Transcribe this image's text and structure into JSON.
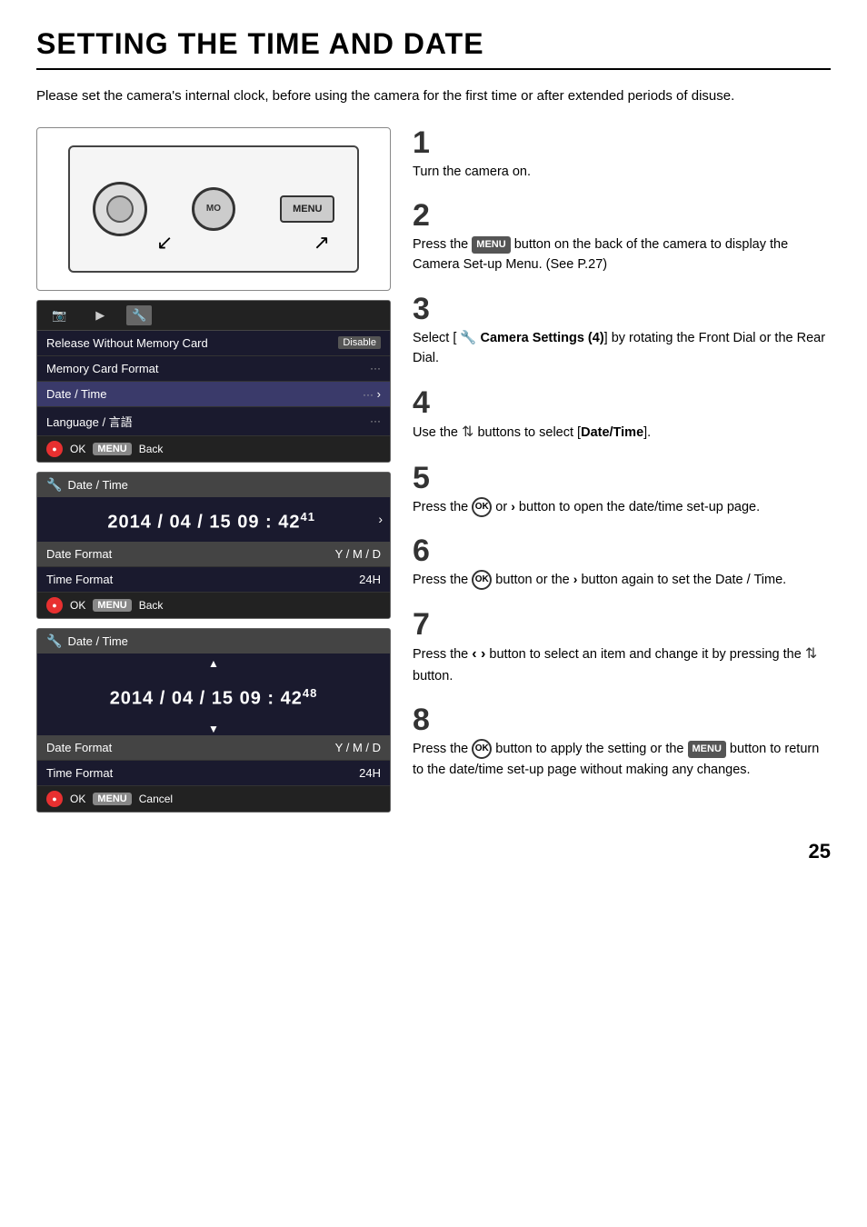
{
  "page": {
    "title": "SETTING THE TIME AND DATE",
    "intro": "Please set the camera's internal clock, before using the camera for the first time or after extended periods of disuse.",
    "page_number": "25"
  },
  "camera_diagram": {
    "mo_label": "MO",
    "menu_label": "MENU"
  },
  "menu_screen1": {
    "tabs": [
      "📷",
      "▶",
      "🔧"
    ],
    "rows": [
      {
        "label": "Release Without Memory Card",
        "value": "Disable"
      },
      {
        "label": "Memory Card Format",
        "value": "···"
      },
      {
        "label": "Date / Time",
        "value": "··· ›"
      },
      {
        "label": "Language / 言語",
        "value": "···"
      }
    ],
    "footer_ok": "OK",
    "footer_menu": "MENU",
    "footer_back": "Back"
  },
  "datetime_screen1": {
    "title": "Date / Time",
    "datetime_value": "2014 / 04 / 15   09 : 42",
    "seconds": "41",
    "date_format_label": "Date Format",
    "date_format_value": "Y / M / D",
    "time_format_label": "Time Format",
    "time_format_value": "24H",
    "footer_ok": "OK",
    "footer_menu": "MENU",
    "footer_back": "Back"
  },
  "datetime_screen2": {
    "title": "Date / Time",
    "datetime_value": "2014 / 04 / 15   09 : 42",
    "seconds": "48",
    "date_format_label": "Date Format",
    "date_format_value": "Y / M / D",
    "time_format_label": "Time Format",
    "time_format_value": "24H",
    "footer_ok": "OK",
    "footer_menu": "MENU",
    "footer_cancel": "Cancel"
  },
  "steps": {
    "s1": {
      "num": "1",
      "text": "Turn the camera on."
    },
    "s2": {
      "num": "2",
      "text_before": "Press the",
      "menu_btn": "MENU",
      "text_after": "button on the back of the camera to display the Camera Set-up Menu. (See P.27)"
    },
    "s3": {
      "num": "3",
      "text": "Select  [ 🔧  Camera  Settings  (4)]  by rotating the Front Dial or the Rear Dial."
    },
    "s4": {
      "num": "4",
      "text_before": "Use the",
      "icon": "⇅",
      "text_after": "buttons to select [Date/Time]."
    },
    "s5": {
      "num": "5",
      "text": "Press  the  OK  or  ›  button  to  open  the date/time set-up page."
    },
    "s6": {
      "num": "6",
      "text": "Press the  OK  button or the  ›  button again to set the Date / Time."
    },
    "s7": {
      "num": "7",
      "text": "Press the ‹› button to select an item and change it by pressing the ⇅ button."
    },
    "s8": {
      "num": "8",
      "text": "Press the  OK  button to apply the setting or the  MENU  button to return to the date/time set-up page without making any changes."
    }
  }
}
